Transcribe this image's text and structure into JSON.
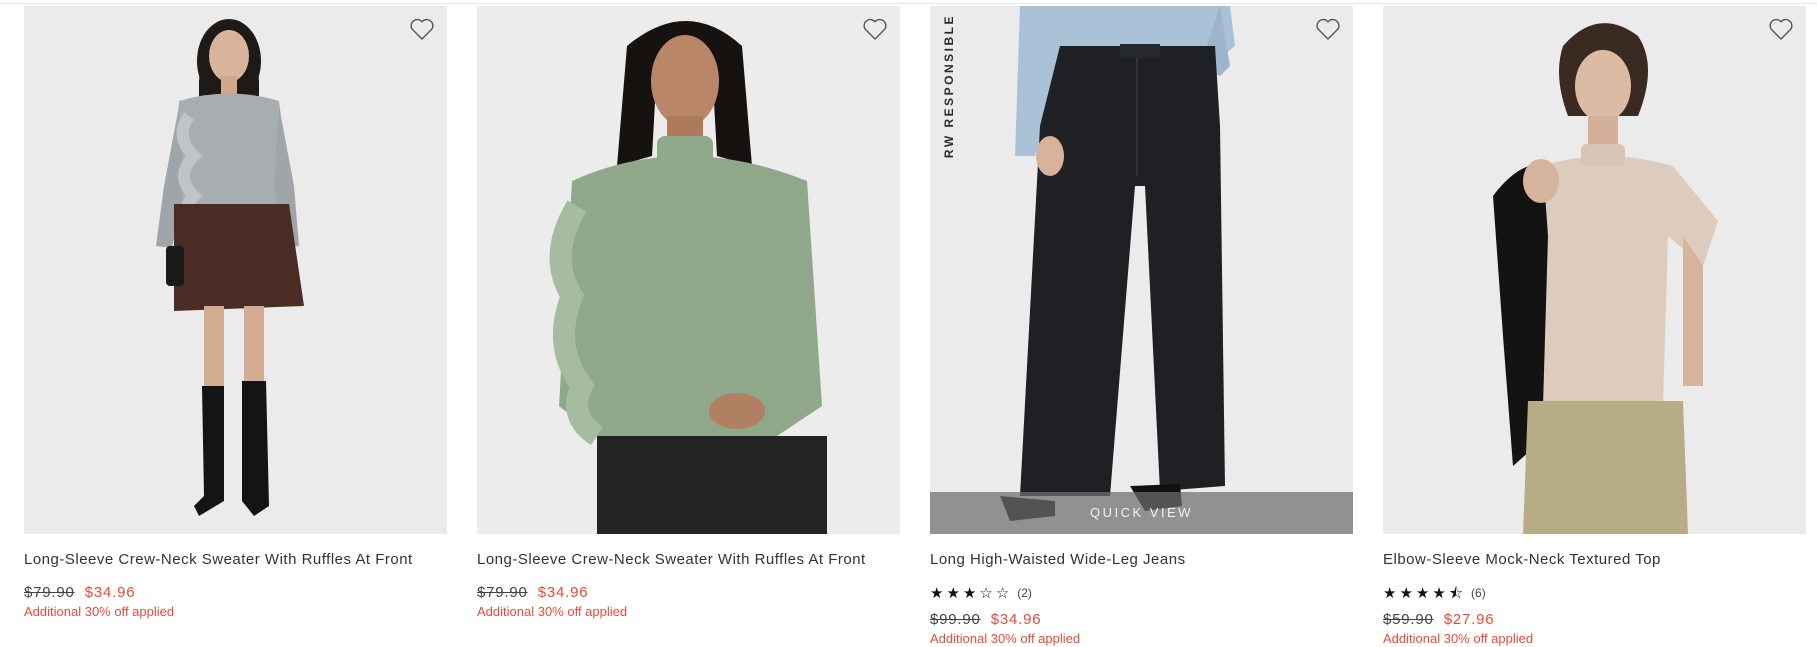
{
  "colors": {
    "sale": "#e44b3b",
    "strike": "#444444",
    "background": "#ffffff",
    "photo_bg": "#ebebeb"
  },
  "products": [
    {
      "name": "Long-Sleeve Crew-Neck Sweater With Ruffles At Front",
      "original_price": "$79.90",
      "sale_price": "$34.96",
      "promo": "Additional 30% off applied",
      "wishlist_icon": "heart-outline-icon"
    },
    {
      "name": "Long-Sleeve Crew-Neck Sweater With Ruffles At Front",
      "original_price": "$79.90",
      "sale_price": "$34.96",
      "promo": "Additional 30% off applied",
      "wishlist_icon": "heart-outline-icon"
    },
    {
      "name": "Long High-Waisted Wide-Leg Jeans",
      "rating": 3,
      "rating_count": "(2)",
      "original_price": "$99.90",
      "sale_price": "$34.96",
      "promo": "Additional 30% off applied",
      "quick_view": "QUICK VIEW",
      "brand_mark": "RW RESPONSIBLE",
      "wishlist_icon": "heart-outline-icon"
    },
    {
      "name": "Elbow-Sleeve Mock-Neck Textured Top",
      "rating": 4.5,
      "rating_count": "(6)",
      "original_price": "$59.90",
      "sale_price": "$27.96",
      "promo": "Additional 30% off applied",
      "wishlist_icon": "heart-outline-icon"
    }
  ]
}
